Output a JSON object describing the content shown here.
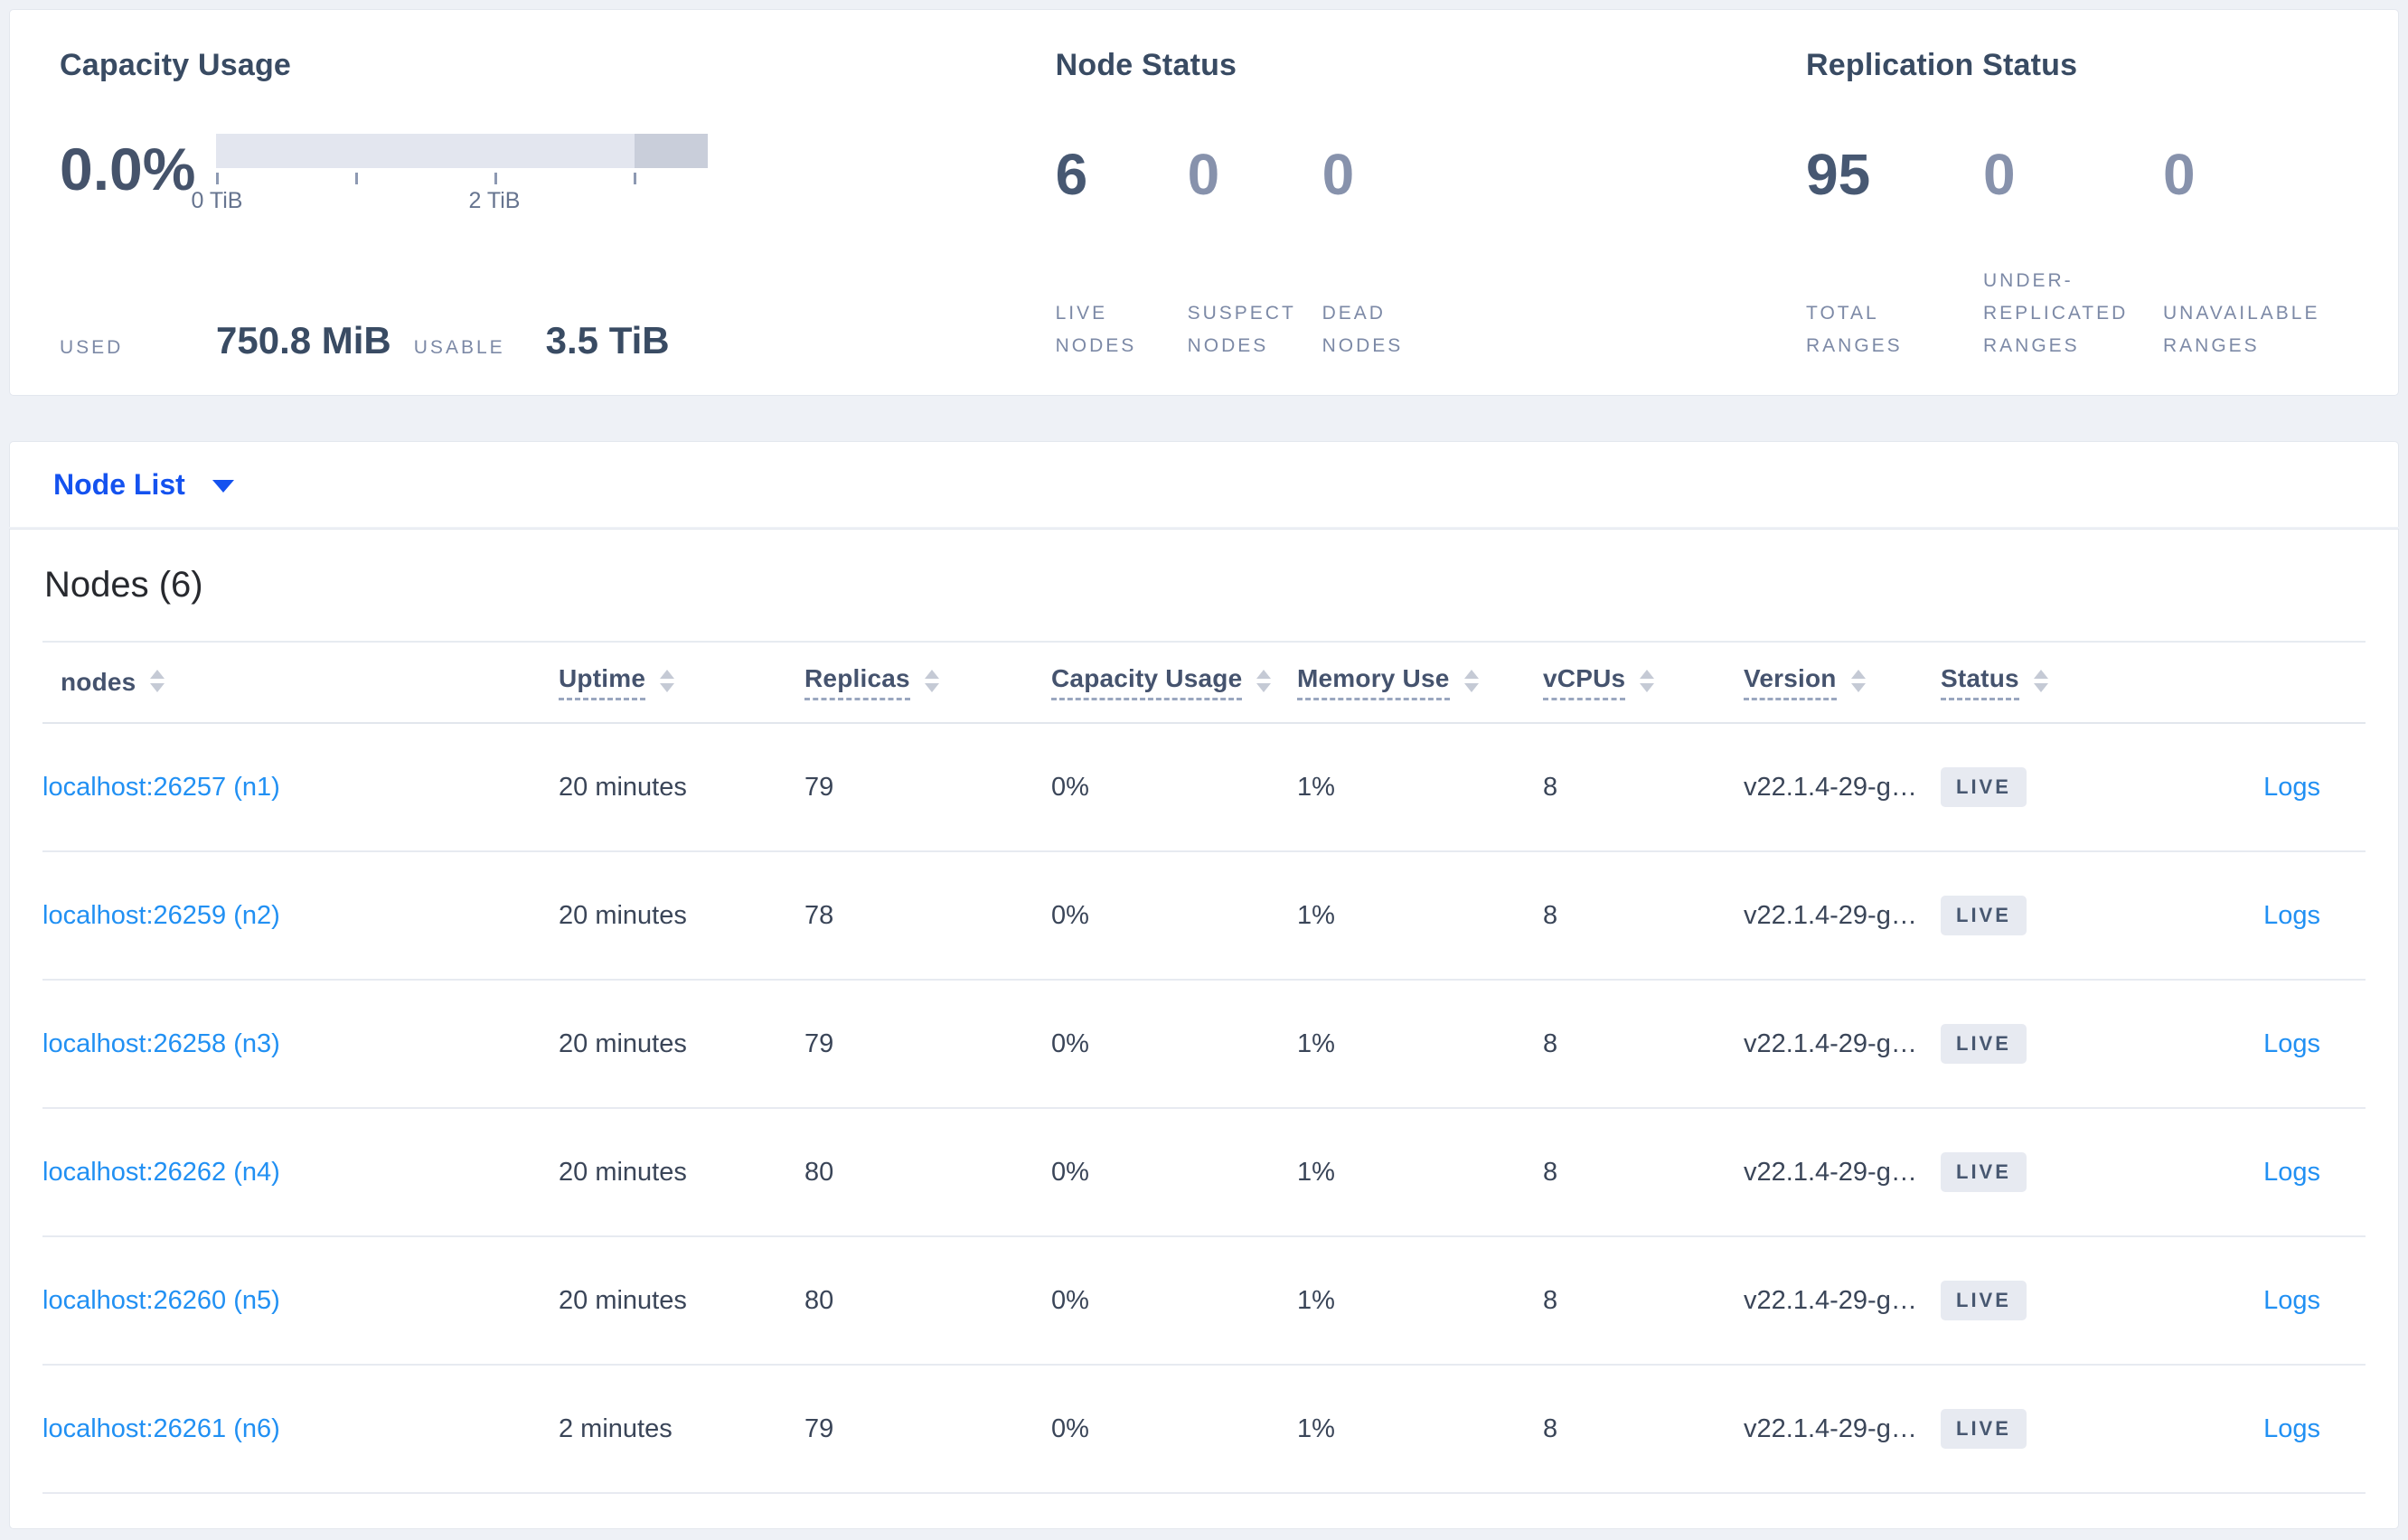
{
  "colors": {
    "page_background": "#eef1f6",
    "card_background": "#ffffff",
    "accent_blue": "#1452ef",
    "link_blue": "#2190f3",
    "dark_slate": "#394b63",
    "muted_slate": "#7c89a6",
    "bar_track": "#e3e6ef",
    "bar_dark_segment": "#c9ceda",
    "badge_background": "#e7eaf1"
  },
  "summary": {
    "capacity_usage": {
      "title": "Capacity Usage",
      "percent": "0.0%",
      "axis_labels": [
        {
          "text": "0 TiB",
          "tick_index": 0
        },
        {
          "text": "2 TiB",
          "tick_index": 2
        }
      ],
      "used_label": "USED",
      "used_value": "750.8 MiB",
      "usable_label": "USABLE",
      "usable_value": "3.5 TiB"
    },
    "node_status": {
      "title": "Node Status",
      "metrics": [
        {
          "value": "6",
          "label": "LIVE NODES",
          "emphasized": true
        },
        {
          "value": "0",
          "label": "SUSPECT NODES",
          "emphasized": false
        },
        {
          "value": "0",
          "label": "DEAD NODES",
          "emphasized": false
        }
      ]
    },
    "replication_status": {
      "title": "Replication Status",
      "metrics": [
        {
          "value": "95",
          "label": "TOTAL RANGES",
          "emphasized": true
        },
        {
          "value": "0",
          "label": "UNDER-REPLICATED RANGES",
          "emphasized": false
        },
        {
          "value": "0",
          "label": "UNAVAILABLE RANGES",
          "emphasized": false
        }
      ]
    }
  },
  "view_selector": {
    "label": "Node List"
  },
  "nodes_table": {
    "title": "Nodes (6)",
    "columns": [
      {
        "label": "nodes",
        "dashed": false
      },
      {
        "label": "Uptime",
        "dashed": true
      },
      {
        "label": "Replicas",
        "dashed": true
      },
      {
        "label": "Capacity Usage",
        "dashed": true
      },
      {
        "label": "Memory Use",
        "dashed": true
      },
      {
        "label": "vCPUs",
        "dashed": true
      },
      {
        "label": "Version",
        "dashed": true
      },
      {
        "label": "Status",
        "dashed": true
      }
    ],
    "rows": [
      {
        "node": "localhost:26257 (n1)",
        "uptime": "20 minutes",
        "replicas": "79",
        "capacity": "0%",
        "memory": "1%",
        "vcpus": "8",
        "version": "v22.1.4-29-g…",
        "status": "LIVE",
        "logs": "Logs"
      },
      {
        "node": "localhost:26259 (n2)",
        "uptime": "20 minutes",
        "replicas": "78",
        "capacity": "0%",
        "memory": "1%",
        "vcpus": "8",
        "version": "v22.1.4-29-g…",
        "status": "LIVE",
        "logs": "Logs"
      },
      {
        "node": "localhost:26258 (n3)",
        "uptime": "20 minutes",
        "replicas": "79",
        "capacity": "0%",
        "memory": "1%",
        "vcpus": "8",
        "version": "v22.1.4-29-g…",
        "status": "LIVE",
        "logs": "Logs"
      },
      {
        "node": "localhost:26262 (n4)",
        "uptime": "20 minutes",
        "replicas": "80",
        "capacity": "0%",
        "memory": "1%",
        "vcpus": "8",
        "version": "v22.1.4-29-g…",
        "status": "LIVE",
        "logs": "Logs"
      },
      {
        "node": "localhost:26260 (n5)",
        "uptime": "20 minutes",
        "replicas": "80",
        "capacity": "0%",
        "memory": "1%",
        "vcpus": "8",
        "version": "v22.1.4-29-g…",
        "status": "LIVE",
        "logs": "Logs"
      },
      {
        "node": "localhost:26261 (n6)",
        "uptime": "2 minutes",
        "replicas": "79",
        "capacity": "0%",
        "memory": "1%",
        "vcpus": "8",
        "version": "v22.1.4-29-g…",
        "status": "LIVE",
        "logs": "Logs"
      }
    ]
  }
}
